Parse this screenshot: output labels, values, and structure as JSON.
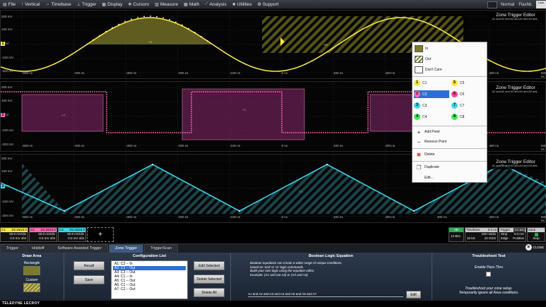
{
  "menu": {
    "items": [
      {
        "icon": "file-icon",
        "glyph": "▤",
        "label": "File"
      },
      {
        "icon": "vertical-icon",
        "glyph": "↕",
        "label": "Vertical"
      },
      {
        "icon": "timebase-icon",
        "glyph": "↔",
        "label": "Timebase"
      },
      {
        "icon": "trigger-icon",
        "glyph": "⊥",
        "label": "Trigger"
      },
      {
        "icon": "display-icon",
        "glyph": "▦",
        "label": "Display"
      },
      {
        "icon": "cursors-icon",
        "glyph": "✥",
        "label": "Cursors"
      },
      {
        "icon": "measure-icon",
        "glyph": "▥",
        "label": "Measure"
      },
      {
        "icon": "math-icon",
        "glyph": "▦",
        "label": "Math"
      },
      {
        "icon": "analysis-icon",
        "glyph": "⟋",
        "label": "Analysis"
      },
      {
        "icon": "utilities-icon",
        "glyph": "✖",
        "label": "Utilities"
      },
      {
        "icon": "support-icon",
        "glyph": "❂",
        "label": "Support"
      }
    ],
    "right": {
      "normal": "Normal",
      "flash": "Flashb.",
      "logo": "Lock"
    }
  },
  "grids": {
    "g1": {
      "y_top": "200 mV",
      "y_mid": "100 mV",
      "y_zero": "0 mV",
      "y_n1": "-100 mV",
      "y_n2": "-200 mV",
      "zte_title": "Zone Trigger Editor",
      "zte_sub": "A1 and A2 and A3 and A4 and A5 and...",
      "area_a": "A4",
      "area_b": "A6",
      "marker": "1"
    },
    "g2": {
      "y_top": "200 mV",
      "y_mid": "100 mV",
      "y_zero": "0 mV",
      "y_n1": "-100 mV",
      "y_n2": "-200 mV",
      "zte_title": "Zone Trigger Editor",
      "zte_sub": "A1 and A2 and A3 and A4 and A5 and...",
      "area_a": "A7",
      "area_b": "A1",
      "marker": "2"
    },
    "g3": {
      "y_top": "200 mV",
      "y_mid": "100 mV",
      "y_zero": "0 mV",
      "y_n1": "-100 mV",
      "y_n2": "-200 mV",
      "zte_title": "Zone Trigger Editor",
      "zte_sub": "A1 and A2 and A3 and A4 and A5 and...",
      "area_a": "A3",
      "marker": "3"
    },
    "xlabels": [
      "-500 ns",
      "-400 ns",
      "-300 ns",
      "-200 ns",
      "-100 ns",
      "0 ns",
      "100 ns",
      "200 ns",
      "300 ns",
      "400 ns",
      "500 ns"
    ]
  },
  "context_menu": {
    "in": "In",
    "out": "Out",
    "dont_care": "Don't Care",
    "channels": [
      {
        "num": "1",
        "label": "C1",
        "color": "#f5e642",
        "selected": false
      },
      {
        "num": "5",
        "label": "C5",
        "color": "#f5e642",
        "selected": false
      },
      {
        "num": "2",
        "label": "C2",
        "color": "#ff69b4",
        "selected": true
      },
      {
        "num": "6",
        "label": "C6",
        "color": "#ff3fa0",
        "selected": false
      },
      {
        "num": "3",
        "label": "C3",
        "color": "#39d5e8",
        "selected": false
      },
      {
        "num": "7",
        "label": "C7",
        "color": "#39d5e8",
        "selected": false
      },
      {
        "num": "4",
        "label": "C4",
        "color": "#3ee84a",
        "selected": false
      },
      {
        "num": "8",
        "label": "C8",
        "color": "#3ee84a",
        "selected": false
      }
    ],
    "add_point": "Add Point",
    "remove_point": "Remove Point",
    "delete": "Delete",
    "duplicate": "Duplicate",
    "edit": "Edit..."
  },
  "channel_strip": {
    "c1": {
      "name": "C1",
      "tag": "DC1M10.0",
      "vdiv": "50.0 mV/div",
      "offset": "0.0 mV ofst"
    },
    "c2": {
      "name": "C2",
      "tag": "DC1M10.0",
      "vdiv": "50.0 mV/div",
      "offset": "0.0 mV ofst"
    },
    "c3": {
      "name": "C3",
      "tag": "DC1M10.0",
      "vdiv": "50.0 mV/div",
      "offset": "0.0 mV ofst"
    },
    "add": "+",
    "bits": {
      "head": "HD",
      "value": "12 Bits"
    },
    "timebase": {
      "head": "Timebase",
      "offset": "0.0 ns",
      "rate": "100 ns/div",
      "k": "10 kS",
      "gs": "10 GS/s"
    },
    "trigger": {
      "head": "Trigger",
      "badge": "C1 DC",
      "mode": "Stop",
      "val": "0.0 mV",
      "edge": "Edge",
      "pos": "Positive"
    },
    "zone": {
      "head": "Zone",
      "state": "Stop"
    }
  },
  "tabs": [
    "Trigger",
    "Holdoff",
    "Software Assisted Trigger",
    "Zone Trigger",
    "TriggerScan"
  ],
  "active_tab": "Zone Trigger",
  "close_label": "CLOSE",
  "dialog": {
    "draw_area": "Draw Area",
    "rectangle": "Rectangle",
    "custom": "Custom",
    "recall": "Recall",
    "save": "Save",
    "config_list_title": "Configuration List",
    "config_list": [
      "A1: C2 -- In",
      "A2: C2 -- Out",
      "A3: C3 -- Out",
      "A4: C1 -- In",
      "A5: C1 -- Out",
      "A6: C1 -- Out",
      "A7: C2 -- Out"
    ],
    "edit_selected": "Edit Selected",
    "delete_selected": "Delete Selected",
    "delete_all": "Delete All",
    "ble_title": "Boolean Logic Equation",
    "ble_lines": [
      "Boolean equations can create a wider range of unique conditions,",
      "based on 'and' or 'or' logic commands.",
      "Build your own logic using the equation editor.",
      "Example: (A1 and not A2) or (A3 and A4)"
    ],
    "equation": "A1 and A2 and A3 and A4 and A5 and A6 and A7",
    "edit": "Edit",
    "ts_title": "Troubleshoot Test",
    "enable_pass": "Enable Pass-Thru",
    "ts_lines": [
      "Troubleshoot your zone setup.",
      "Temporarily ignore all Area conditions."
    ]
  },
  "footer": "TELEDYNE LECROY",
  "colors": {
    "c1": "#f5e642",
    "c2": "#ff69b4",
    "c3": "#39d5e8",
    "accent": "#2b6fd6"
  }
}
